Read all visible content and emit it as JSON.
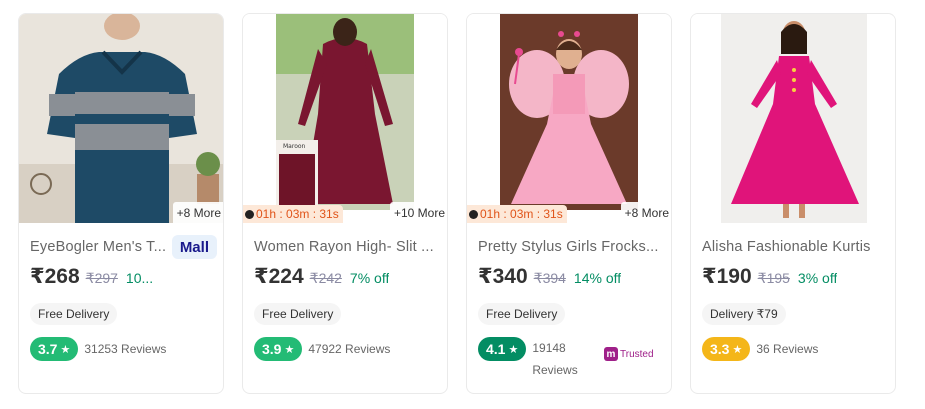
{
  "products": [
    {
      "title": "EyeBogler Men's T...",
      "price": "₹268",
      "mrp": "₹297",
      "discount": "10...",
      "more": "+8 More",
      "timer": "",
      "mall": "Mall",
      "delivery": "Free Delivery",
      "rating": "3.7",
      "rating_color": "#23bb75",
      "reviews": "31253 Reviews"
    },
    {
      "title": "Women Rayon High- Slit ...",
      "price": "₹224",
      "mrp": "₹242",
      "discount": "7% off",
      "more": "+10 More",
      "timer": "01h : 03m : 31s",
      "delivery": "Free Delivery",
      "rating": "3.9",
      "rating_color": "#23bb75",
      "reviews": "47922 Reviews",
      "image_label": "Maroon"
    },
    {
      "title": "Pretty Stylus Girls Frocks...",
      "price": "₹340",
      "mrp": "₹394",
      "discount": "14% off",
      "more": "+8 More",
      "timer": "01h : 03m : 31s",
      "delivery": "Free Delivery",
      "rating": "4.1",
      "rating_color": "#038d63",
      "reviews": "19148 Reviews",
      "trusted": "Trusted"
    },
    {
      "title": "Alisha Fashionable Kurtis",
      "price": "₹190",
      "mrp": "₹195",
      "discount": "3% off",
      "delivery": "Delivery ₹79",
      "rating": "3.3",
      "rating_color": "#f4b619",
      "reviews": "36 Reviews"
    }
  ]
}
